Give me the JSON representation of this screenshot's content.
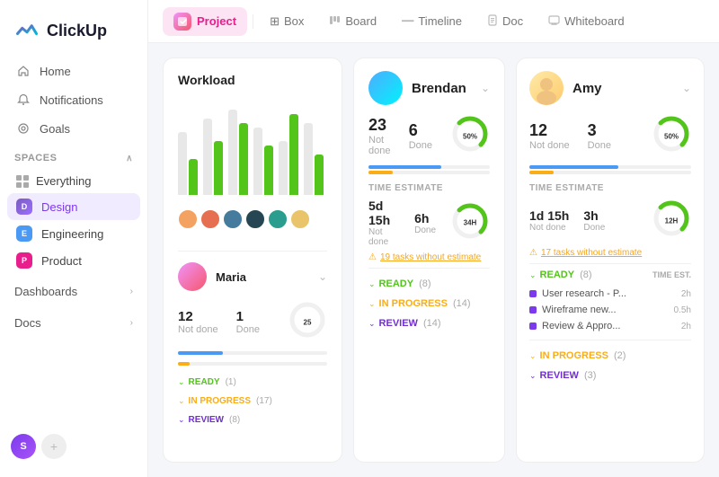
{
  "app": {
    "name": "ClickUp"
  },
  "sidebar": {
    "nav": [
      {
        "id": "home",
        "label": "Home",
        "icon": "🏠"
      },
      {
        "id": "notifications",
        "label": "Notifications",
        "icon": "🔔"
      },
      {
        "id": "goals",
        "label": "Goals",
        "icon": "🎯"
      }
    ],
    "spaces_label": "Spaces",
    "spaces": [
      {
        "id": "everything",
        "label": "Everything"
      },
      {
        "id": "design",
        "label": "Design",
        "letter": "D",
        "color": "dot-purple",
        "active": true
      },
      {
        "id": "engineering",
        "label": "Engineering",
        "letter": "E",
        "color": "dot-blue"
      },
      {
        "id": "product",
        "label": "Product",
        "letter": "P",
        "color": "dot-pink"
      }
    ],
    "sections": [
      {
        "id": "dashboards",
        "label": "Dashboards"
      },
      {
        "id": "docs",
        "label": "Docs"
      }
    ],
    "bottom_user": "S"
  },
  "topnav": {
    "project_label": "Project",
    "tabs": [
      {
        "id": "box",
        "label": "Box",
        "icon": "⊞"
      },
      {
        "id": "board",
        "label": "Board",
        "icon": "☰"
      },
      {
        "id": "timeline",
        "label": "Timeline",
        "icon": "—"
      },
      {
        "id": "doc",
        "label": "Doc",
        "icon": "📄"
      },
      {
        "id": "whiteboard",
        "label": "Whiteboard",
        "icon": "⬜"
      }
    ]
  },
  "workload": {
    "title": "Workload",
    "bars": [
      {
        "gray": 70,
        "green": 40
      },
      {
        "gray": 85,
        "green": 60
      },
      {
        "gray": 95,
        "green": 80
      },
      {
        "gray": 75,
        "green": 55
      },
      {
        "gray": 60,
        "green": 90
      },
      {
        "gray": 80,
        "green": 45
      }
    ]
  },
  "brendan": {
    "name": "Brendan",
    "not_done": 23,
    "done": 6,
    "percent": 50,
    "progress_blue": 60,
    "progress_yellow": 20,
    "time_est_label": "TIME ESTIMATE",
    "time_not_done": "5d 15h",
    "time_done": "6h",
    "time_total": "34H",
    "warn_text": "19 tasks without estimate",
    "sections": [
      {
        "label": "READY",
        "count": "(8)",
        "color": "ready-color"
      },
      {
        "label": "IN PROGRESS",
        "count": "(14)",
        "color": "inprog-color"
      },
      {
        "label": "REVIEW",
        "count": "(14)",
        "color": "review-color"
      }
    ]
  },
  "maria": {
    "name": "Maria",
    "not_done": 12,
    "done": 1,
    "percent": 25,
    "progress_blue": 30,
    "progress_yellow": 8,
    "sections": [
      {
        "label": "READY",
        "count": "(1)",
        "color": "ready-color"
      },
      {
        "label": "IN PROGRESS",
        "count": "(17)",
        "color": "inprog-color"
      },
      {
        "label": "REVIEW",
        "count": "(8)",
        "color": "review-color"
      }
    ]
  },
  "amy": {
    "name": "Amy",
    "not_done": 12,
    "done": 3,
    "percent": 50,
    "progress_blue": 55,
    "progress_yellow": 15,
    "time_est_label": "TIME ESTIMATE",
    "time_not_done": "1d 15h",
    "time_done": "3h",
    "time_total": "12H",
    "warn_text": "17 tasks without estimate",
    "ready_label": "READY",
    "ready_count": "(8)",
    "time_est_col": "TIME EST.",
    "tasks": [
      {
        "label": "User research - P...",
        "time": "2h"
      },
      {
        "label": "Wireframe new...",
        "time": "0.5h"
      },
      {
        "label": "Review & Appro...",
        "time": "2h"
      }
    ],
    "sections": [
      {
        "label": "READY",
        "count": "(8)",
        "color": "ready-color"
      },
      {
        "label": "IN PROGRESS",
        "count": "(2)",
        "color": "inprog-color"
      },
      {
        "label": "REVIEW",
        "count": "(3)",
        "color": "review-color"
      }
    ]
  }
}
